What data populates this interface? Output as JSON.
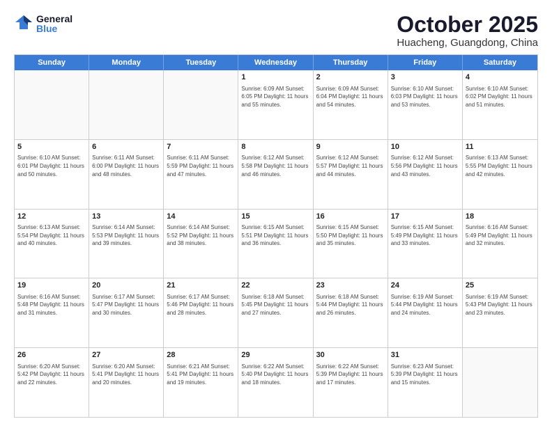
{
  "header": {
    "logo_general": "General",
    "logo_blue": "Blue",
    "title": "October 2025",
    "location": "Huacheng, Guangdong, China"
  },
  "weekdays": [
    "Sunday",
    "Monday",
    "Tuesday",
    "Wednesday",
    "Thursday",
    "Friday",
    "Saturday"
  ],
  "weeks": [
    [
      {
        "day": "",
        "info": ""
      },
      {
        "day": "",
        "info": ""
      },
      {
        "day": "",
        "info": ""
      },
      {
        "day": "1",
        "info": "Sunrise: 6:09 AM\nSunset: 6:05 PM\nDaylight: 11 hours\nand 55 minutes."
      },
      {
        "day": "2",
        "info": "Sunrise: 6:09 AM\nSunset: 6:04 PM\nDaylight: 11 hours\nand 54 minutes."
      },
      {
        "day": "3",
        "info": "Sunrise: 6:10 AM\nSunset: 6:03 PM\nDaylight: 11 hours\nand 53 minutes."
      },
      {
        "day": "4",
        "info": "Sunrise: 6:10 AM\nSunset: 6:02 PM\nDaylight: 11 hours\nand 51 minutes."
      }
    ],
    [
      {
        "day": "5",
        "info": "Sunrise: 6:10 AM\nSunset: 6:01 PM\nDaylight: 11 hours\nand 50 minutes."
      },
      {
        "day": "6",
        "info": "Sunrise: 6:11 AM\nSunset: 6:00 PM\nDaylight: 11 hours\nand 48 minutes."
      },
      {
        "day": "7",
        "info": "Sunrise: 6:11 AM\nSunset: 5:59 PM\nDaylight: 11 hours\nand 47 minutes."
      },
      {
        "day": "8",
        "info": "Sunrise: 6:12 AM\nSunset: 5:58 PM\nDaylight: 11 hours\nand 46 minutes."
      },
      {
        "day": "9",
        "info": "Sunrise: 6:12 AM\nSunset: 5:57 PM\nDaylight: 11 hours\nand 44 minutes."
      },
      {
        "day": "10",
        "info": "Sunrise: 6:12 AM\nSunset: 5:56 PM\nDaylight: 11 hours\nand 43 minutes."
      },
      {
        "day": "11",
        "info": "Sunrise: 6:13 AM\nSunset: 5:55 PM\nDaylight: 11 hours\nand 42 minutes."
      }
    ],
    [
      {
        "day": "12",
        "info": "Sunrise: 6:13 AM\nSunset: 5:54 PM\nDaylight: 11 hours\nand 40 minutes."
      },
      {
        "day": "13",
        "info": "Sunrise: 6:14 AM\nSunset: 5:53 PM\nDaylight: 11 hours\nand 39 minutes."
      },
      {
        "day": "14",
        "info": "Sunrise: 6:14 AM\nSunset: 5:52 PM\nDaylight: 11 hours\nand 38 minutes."
      },
      {
        "day": "15",
        "info": "Sunrise: 6:15 AM\nSunset: 5:51 PM\nDaylight: 11 hours\nand 36 minutes."
      },
      {
        "day": "16",
        "info": "Sunrise: 6:15 AM\nSunset: 5:50 PM\nDaylight: 11 hours\nand 35 minutes."
      },
      {
        "day": "17",
        "info": "Sunrise: 6:15 AM\nSunset: 5:49 PM\nDaylight: 11 hours\nand 33 minutes."
      },
      {
        "day": "18",
        "info": "Sunrise: 6:16 AM\nSunset: 5:49 PM\nDaylight: 11 hours\nand 32 minutes."
      }
    ],
    [
      {
        "day": "19",
        "info": "Sunrise: 6:16 AM\nSunset: 5:48 PM\nDaylight: 11 hours\nand 31 minutes."
      },
      {
        "day": "20",
        "info": "Sunrise: 6:17 AM\nSunset: 5:47 PM\nDaylight: 11 hours\nand 30 minutes."
      },
      {
        "day": "21",
        "info": "Sunrise: 6:17 AM\nSunset: 5:46 PM\nDaylight: 11 hours\nand 28 minutes."
      },
      {
        "day": "22",
        "info": "Sunrise: 6:18 AM\nSunset: 5:45 PM\nDaylight: 11 hours\nand 27 minutes."
      },
      {
        "day": "23",
        "info": "Sunrise: 6:18 AM\nSunset: 5:44 PM\nDaylight: 11 hours\nand 26 minutes."
      },
      {
        "day": "24",
        "info": "Sunrise: 6:19 AM\nSunset: 5:44 PM\nDaylight: 11 hours\nand 24 minutes."
      },
      {
        "day": "25",
        "info": "Sunrise: 6:19 AM\nSunset: 5:43 PM\nDaylight: 11 hours\nand 23 minutes."
      }
    ],
    [
      {
        "day": "26",
        "info": "Sunrise: 6:20 AM\nSunset: 5:42 PM\nDaylight: 11 hours\nand 22 minutes."
      },
      {
        "day": "27",
        "info": "Sunrise: 6:20 AM\nSunset: 5:41 PM\nDaylight: 11 hours\nand 20 minutes."
      },
      {
        "day": "28",
        "info": "Sunrise: 6:21 AM\nSunset: 5:41 PM\nDaylight: 11 hours\nand 19 minutes."
      },
      {
        "day": "29",
        "info": "Sunrise: 6:22 AM\nSunset: 5:40 PM\nDaylight: 11 hours\nand 18 minutes."
      },
      {
        "day": "30",
        "info": "Sunrise: 6:22 AM\nSunset: 5:39 PM\nDaylight: 11 hours\nand 17 minutes."
      },
      {
        "day": "31",
        "info": "Sunrise: 6:23 AM\nSunset: 5:39 PM\nDaylight: 11 hours\nand 15 minutes."
      },
      {
        "day": "",
        "info": ""
      }
    ]
  ]
}
